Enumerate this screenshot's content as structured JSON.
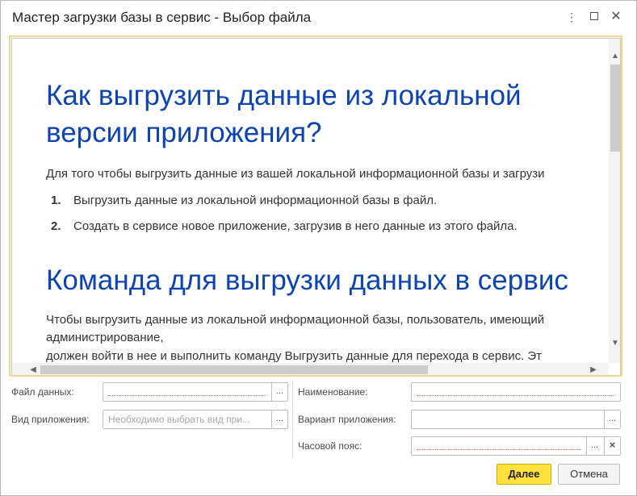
{
  "window": {
    "title": "Мастер загрузки базы в сервис - Выбор файла",
    "more_icon": "⋮",
    "close_icon": "✕"
  },
  "content": {
    "heading1_line1": "Как выгрузить данные из локальной",
    "heading1_line2": "версии приложения?",
    "intro": "Для того чтобы выгрузить данные из вашей локальной информационной базы и загрузи",
    "steps": [
      {
        "num": "1.",
        "text": "Выгрузить данные из локальной информационной базы в файл."
      },
      {
        "num": "2.",
        "text": "Создать в сервисе новое приложение, загрузив в него данные из этого файла."
      }
    ],
    "heading2": "Команда для выгрузки данных в сервис",
    "para_line1": "Чтобы выгрузить данные из локальной информационной базы, пользователь, имеющий",
    "para_line2": "администрирование,",
    "para_line3": "должен войти в нее и выполнить команду Выгрузить данные для перехода в сервис. Эт"
  },
  "form": {
    "data_file_label": "Файл данных:",
    "data_file_value": "",
    "app_type_label": "Вид приложения:",
    "app_type_placeholder": "Необходимо выбрать вид при...",
    "name_label": "Наименование:",
    "name_value": "",
    "app_variant_label": "Вариант приложения:",
    "app_variant_value": "",
    "timezone_label": "Часовой пояс:",
    "timezone_value": "",
    "select_glyph": "...",
    "clear_glyph": "×"
  },
  "buttons": {
    "next": "Далее",
    "cancel": "Отмена"
  },
  "colors": {
    "heading": "#0d44b1",
    "primary_button": "#ffe03c",
    "panel_focus_border": "#f2d88c"
  }
}
